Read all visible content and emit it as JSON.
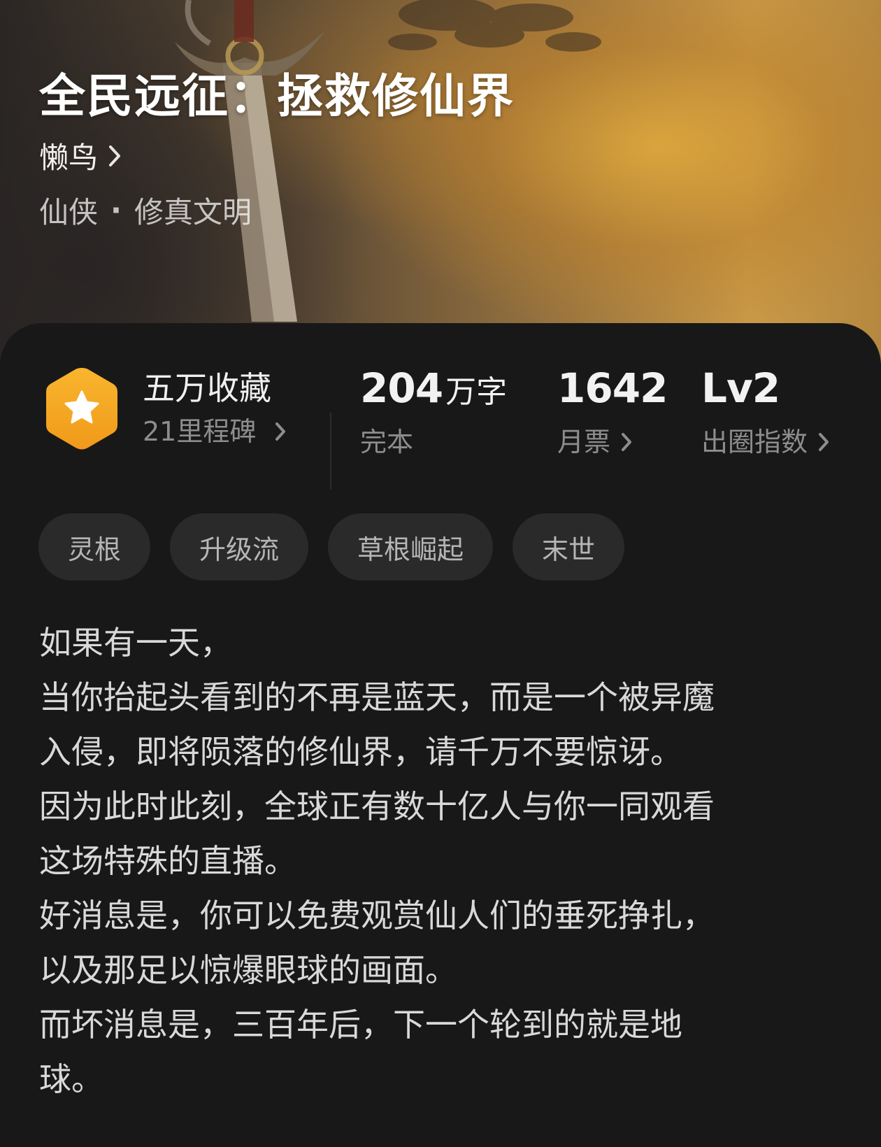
{
  "book": {
    "title": "全民远征：拯救修仙界",
    "author": "懒鸟",
    "genre": "仙侠",
    "subgenre": "修真文明",
    "genre_separator": "·"
  },
  "stats": {
    "collection_label": "五万收藏",
    "milestone_label": "21里程碑",
    "word_count": "204",
    "word_unit": "万字",
    "status": "完本",
    "monthly_tickets": "1642",
    "monthly_tickets_label": "月票",
    "index_level": "Lv2",
    "index_label": "出圈指数"
  },
  "tags": [
    "灵根",
    "升级流",
    "草根崛起",
    "末世"
  ],
  "synopsis": [
    "如果有一天，",
    "当你抬起头看到的不再是蓝天，而是一个被异魔",
    "入侵，即将陨落的修仙界，请千万不要惊讶。",
    "因为此时此刻，全球正有数十亿人与你一同观看",
    "这场特殊的直播。",
    "好消息是，你可以免费观赏仙人们的垂死挣扎，",
    "以及那足以惊爆眼球的画面。",
    "而坏消息是，三百年后，下一个轮到的就是地",
    "球。"
  ],
  "colors": {
    "background": "#181818",
    "badge_orange": "#f7a928",
    "tag_bg": "#2a2a2a",
    "text_primary": "#f0f0f0",
    "text_secondary": "#8d8d8d"
  },
  "icons": {
    "badge": "hexagon-star-icon",
    "chevron": "chevron-right-icon"
  }
}
